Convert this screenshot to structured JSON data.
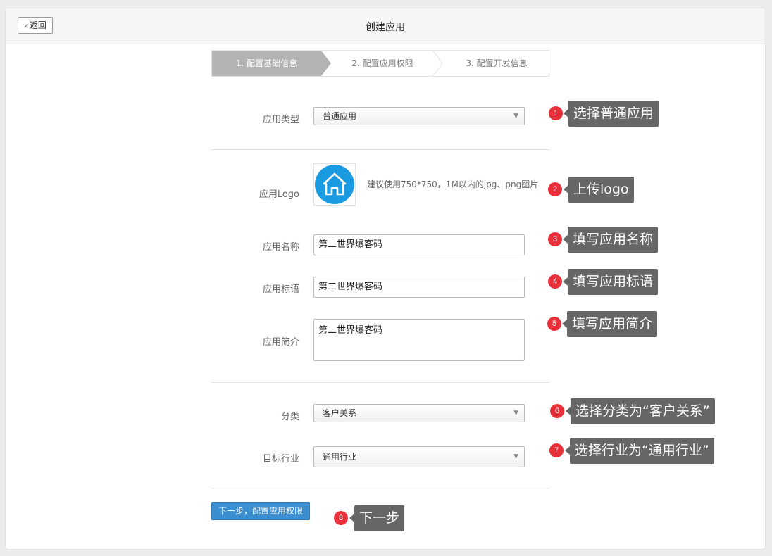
{
  "header": {
    "back_label": "返回",
    "title": "创建应用"
  },
  "steps": [
    "1. 配置基础信息",
    "2. 配置应用权限",
    "3. 配置开发信息"
  ],
  "form": {
    "app_type": {
      "label": "应用类型",
      "value": "普通应用"
    },
    "logo": {
      "label": "应用Logo",
      "hint": "建议使用750*750，1M以内的jpg、png图片"
    },
    "name": {
      "label": "应用名称",
      "value": "第二世界爆客码"
    },
    "slogan": {
      "label": "应用标语",
      "value": "第二世界爆客码"
    },
    "intro": {
      "label": "应用简介",
      "value": "第二世界爆客码"
    },
    "category": {
      "label": "分类",
      "value": "客户关系"
    },
    "industry": {
      "label": "目标行业",
      "value": "通用行业"
    }
  },
  "next_button": "下一步，配置应用权限",
  "annotations": [
    {
      "num": "1",
      "text": "选择普通应用"
    },
    {
      "num": "2",
      "text": "上传logo"
    },
    {
      "num": "3",
      "text": "填写应用名称"
    },
    {
      "num": "4",
      "text": "填写应用标语"
    },
    {
      "num": "5",
      "text": "填写应用简介"
    },
    {
      "num": "6",
      "text": "选择分类为“客户关系”"
    },
    {
      "num": "7",
      "text": "选择行业为“通用行业”"
    },
    {
      "num": "8",
      "text": "下一步"
    }
  ],
  "colors": {
    "accent": "#3b8ed0",
    "badge": "#e8303a",
    "callout": "#666666",
    "logo": "#1a9ae0",
    "active_step": "#b3b3b3"
  }
}
